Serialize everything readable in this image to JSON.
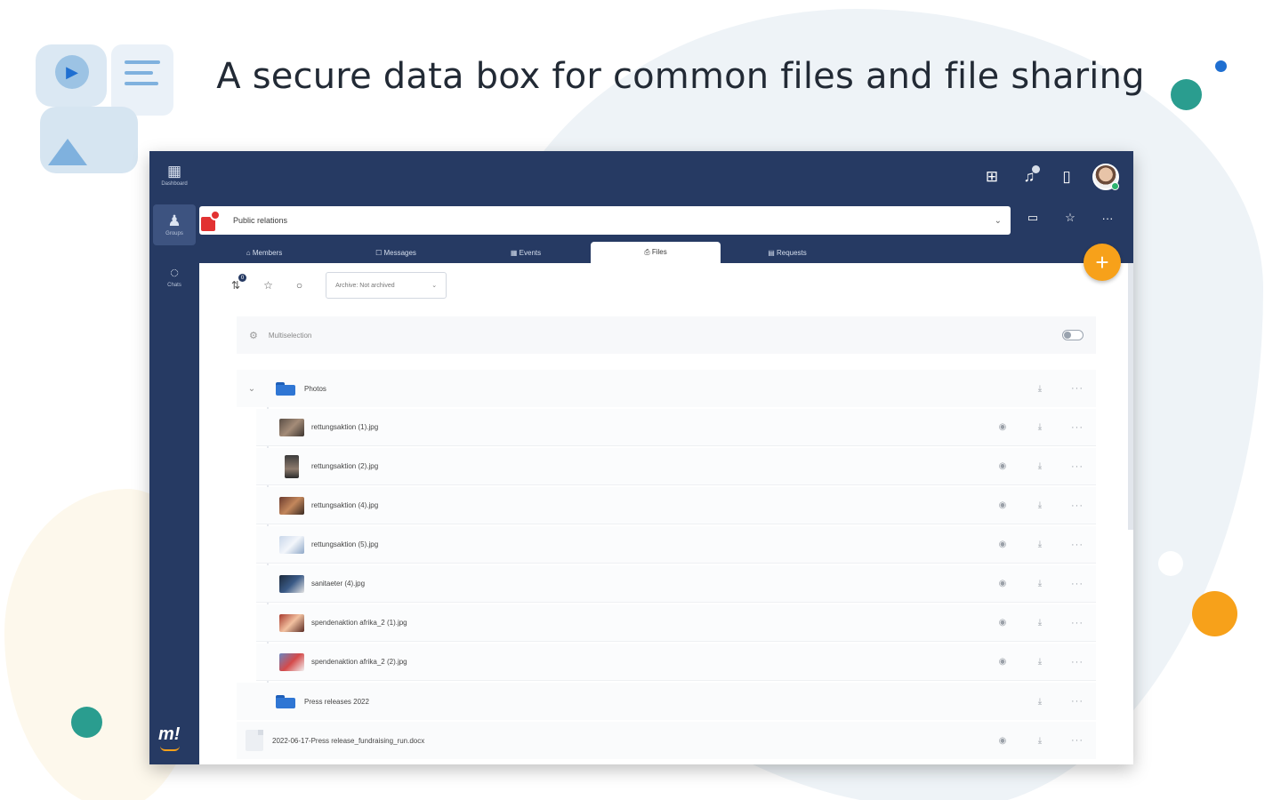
{
  "headline": "A secure data box for common files and file sharing",
  "rail": {
    "items": [
      {
        "icon": "dashboard-icon",
        "label": "Dashboard"
      },
      {
        "icon": "groups-icon",
        "label": "Groups"
      },
      {
        "icon": "chats-icon",
        "label": "Chats"
      }
    ],
    "logo": "m!"
  },
  "group": {
    "name": "Public relations"
  },
  "tabs": [
    {
      "label": "⌂ Members",
      "active": false
    },
    {
      "label": "☐ Messages",
      "active": false
    },
    {
      "label": "▦ Events",
      "active": false
    },
    {
      "label": "⎙ Files",
      "active": true
    },
    {
      "label": "▤ Requests",
      "active": false
    }
  ],
  "toolbar": {
    "filter_count": "0",
    "archive_select": "Archive: Not archived"
  },
  "multiselect": {
    "label": "Multiselection"
  },
  "folders": [
    {
      "name": "Photos",
      "expanded": true,
      "files": [
        {
          "name": "rettungsaktion (1).jpg"
        },
        {
          "name": "rettungsaktion (2).jpg"
        },
        {
          "name": "rettungsaktion (4).jpg"
        },
        {
          "name": "rettungsaktion (5).jpg"
        },
        {
          "name": "sanitaeter (4).jpg"
        },
        {
          "name": "spendenaktion afrika_2 (1).jpg"
        },
        {
          "name": "spendenaktion afrika_2 (2).jpg"
        }
      ]
    },
    {
      "name": "Press releases 2022",
      "expanded": false,
      "files": []
    }
  ],
  "root_files": [
    {
      "name": "2022-06-17-Press release_fundraising_run.docx"
    }
  ],
  "colors": {
    "navy": "#263a63",
    "accent_orange": "#f7a11a",
    "teal": "#2a9d8f",
    "folder_blue": "#2f76d4"
  }
}
